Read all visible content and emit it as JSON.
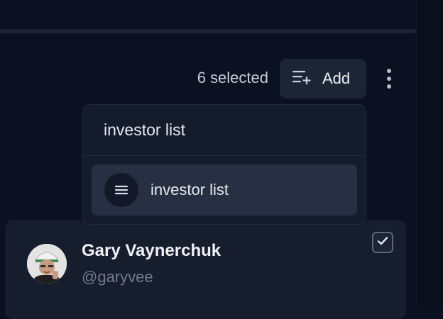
{
  "toolbar": {
    "selected_count": "6 selected",
    "add_label": "Add",
    "add_icon": "list-add-icon",
    "more_icon": "more-vertical-icon"
  },
  "list_dropdown": {
    "search_value": "investor list",
    "options": [
      {
        "label": "investor list",
        "icon": "list-icon"
      }
    ]
  },
  "profile": {
    "name": "Gary Vaynerchuk",
    "handle": "@garyvee",
    "selected": true
  },
  "colors": {
    "background": "#0b1120",
    "card": "#161e2d",
    "button": "#1c2536",
    "option_highlight": "#273042",
    "muted_text": "#717a8b"
  }
}
